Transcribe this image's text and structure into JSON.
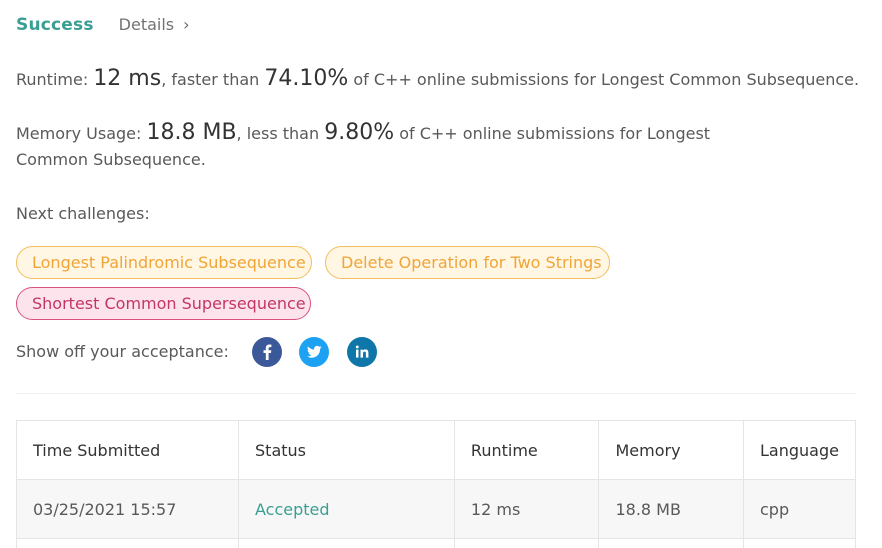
{
  "header": {
    "success_tab": "Success",
    "details_tab": "Details",
    "details_chevron": "›"
  },
  "runtime": {
    "prefix": "Runtime: ",
    "value": "12 ms",
    "middle": ", faster than ",
    "percent": "74.10%",
    "suffix": " of C++ online submissions for Longest Common Subsequence."
  },
  "memory": {
    "prefix": "Memory Usage: ",
    "value": "18.8 MB",
    "middle": ", less than ",
    "percent": "9.80%",
    "suffix": " of C++ online submissions for Longest Common Subsequence."
  },
  "next_challenges": {
    "label": "Next challenges:",
    "items": [
      {
        "title": "Longest Palindromic Subsequence",
        "difficulty": "medium"
      },
      {
        "title": "Delete Operation for Two Strings",
        "difficulty": "medium"
      },
      {
        "title": "Shortest Common Supersequence",
        "difficulty": "hard"
      }
    ]
  },
  "share": {
    "label": "Show off your acceptance:",
    "icons": [
      "facebook-icon",
      "twitter-icon",
      "linkedin-icon"
    ]
  },
  "colors": {
    "success": "#3a9f93",
    "medium_text": "#f0a538",
    "hard_text": "#c33566",
    "facebook": "#3b5998",
    "twitter": "#1da1f2",
    "linkedin": "#0e76a8"
  },
  "submissions": {
    "columns": [
      "Time Submitted",
      "Status",
      "Runtime",
      "Memory",
      "Language"
    ],
    "rows": [
      {
        "time": "03/25/2021 15:57",
        "status": "Accepted",
        "runtime": "12 ms",
        "memory": "18.8 MB",
        "language": "cpp"
      }
    ]
  }
}
